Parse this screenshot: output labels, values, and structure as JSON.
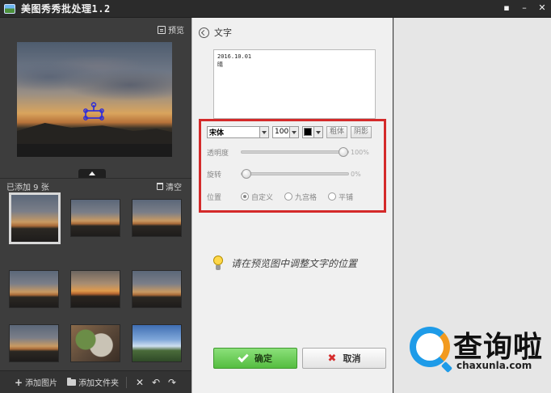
{
  "window": {
    "title": "美图秀秀批处理1.2",
    "controls": [
      "▪",
      "–",
      "✕"
    ]
  },
  "left_panel": {
    "preview_label": "预览",
    "added_count_label": "已添加 9 张",
    "clear_label": "清空",
    "thumbnails": [
      {
        "kind": "sunset",
        "selected": true
      },
      {
        "kind": "sunset",
        "selected": false
      },
      {
        "kind": "sunset",
        "selected": false
      },
      {
        "kind": "sunset",
        "selected": false
      },
      {
        "kind": "sunset2",
        "selected": false
      },
      {
        "kind": "sunset",
        "selected": false
      },
      {
        "kind": "sunset",
        "selected": false
      },
      {
        "kind": "food",
        "selected": false
      },
      {
        "kind": "sky",
        "selected": false
      }
    ],
    "bottom": {
      "add_image_label": "添加图片",
      "add_folder_label": "添加文件夹",
      "delete_glyph": "✕",
      "rotate_left_glyph": "↶",
      "rotate_right_glyph": "↷"
    }
  },
  "editor": {
    "back_label": "文字",
    "text_lines": [
      "2016.10.01",
      "晴"
    ],
    "font": {
      "family_value": "宋体",
      "size_value": "100",
      "color": "#000000",
      "bold_label": "粗体",
      "shadow_label": "阴影"
    },
    "opacity": {
      "label": "透明度",
      "value_text": "100%",
      "value": 1.0
    },
    "rotation": {
      "label": "旋转",
      "value_text": "0%",
      "value": 0.0
    },
    "position": {
      "label": "位置",
      "options": [
        {
          "label": "自定义",
          "checked": true
        },
        {
          "label": "九宫格",
          "checked": false
        },
        {
          "label": "平铺",
          "checked": false
        }
      ]
    },
    "hint": "请在预览图中调整文字的位置",
    "ok_label": "确定",
    "cancel_label": "取消"
  },
  "watermark": {
    "cn": "查询啦",
    "en": "chaxunla.com"
  },
  "colors": {
    "highlight_border": "#d42a2a",
    "ok_green": "#55bd40",
    "logo_blue": "#1e9be8",
    "logo_orange": "#f29a1f"
  }
}
